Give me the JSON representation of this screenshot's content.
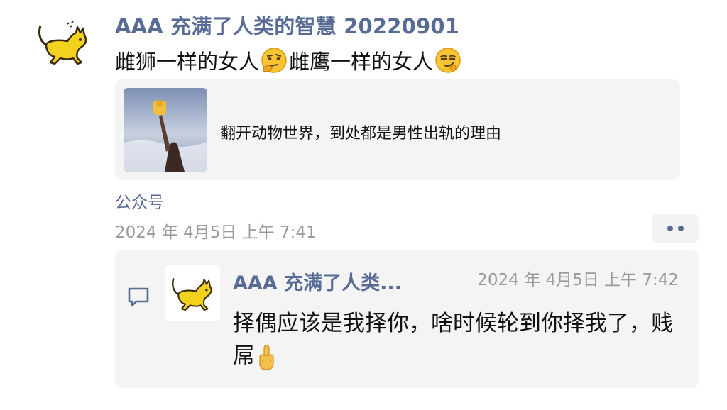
{
  "post": {
    "author": "AAA 充满了人类的智慧 20220901",
    "text_part1": "雌狮一样的女人",
    "emoji1": "thinking-face-emoji",
    "text_part2": "雌鹰一样的女人",
    "emoji2": "smirking-face-emoji",
    "article": {
      "thumbnail": "lion-king-image",
      "title": "翻开动物世界，到处都是男性出轨的理由"
    },
    "source": "公众号",
    "time": "2024 年 4月5日 上午 7:41",
    "more_icon": "more-dots-icon"
  },
  "comment": {
    "icon": "comment-icon",
    "author": "AAA 充满了人类...",
    "time": "2024 年 4月5日 上午 7:42",
    "text": "择偶应该是我择你，啥时候轮到你择我了，贱屌",
    "emoji": "middle-finger-emoji"
  },
  "colors": {
    "link": "#576b95",
    "muted": "#9a9a9a",
    "card_bg": "#f4f4f4",
    "avatar_cat": "#f2d21c"
  }
}
